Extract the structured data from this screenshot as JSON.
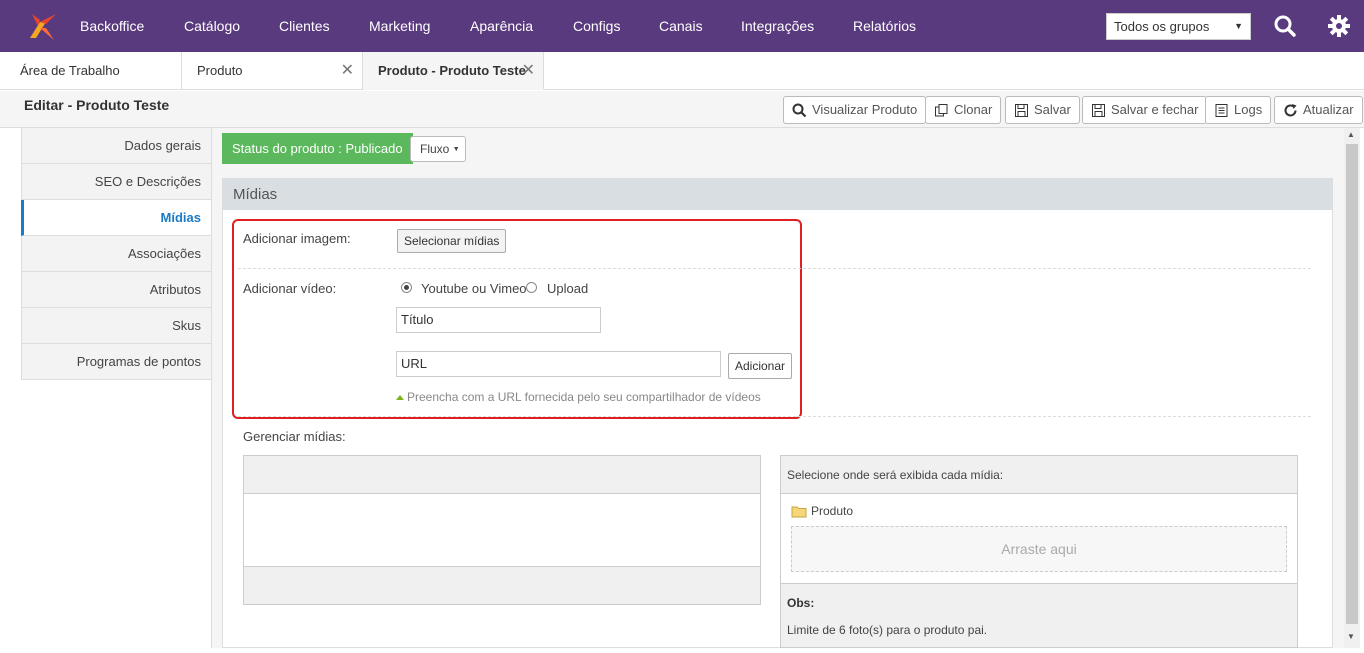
{
  "nav": {
    "brand": "Backoffice",
    "items": [
      "Catálogo",
      "Clientes",
      "Marketing",
      "Aparência",
      "Configs",
      "Canais",
      "Integrações",
      "Relatórios"
    ],
    "group_select": "Todos os grupos",
    "brand_color": "#5a3a7e"
  },
  "tabs": [
    {
      "label": "Área de Trabalho"
    },
    {
      "label": "Produto"
    },
    {
      "label": "Produto - Produto Teste"
    }
  ],
  "editor": {
    "title": "Editar - Produto Teste",
    "buttons": [
      "Visualizar Produto",
      "Clonar",
      "Salvar",
      "Salvar e fechar",
      "Logs",
      "Atualizar"
    ]
  },
  "sidemenu": [
    "Dados gerais",
    "SEO e Descrições",
    "Mídias",
    "Associações",
    "Atributos",
    "Skus",
    "Programas de pontos"
  ],
  "status": {
    "label": "Status do produto : Publicado",
    "flow": "Fluxo"
  },
  "midias": {
    "panel_title": "Mídias",
    "add_image_label": "Adicionar imagem:",
    "select_media_button": "Selecionar mídias",
    "add_video_label": "Adicionar vídeo:",
    "radio_youtube": "Youtube ou Vimeo",
    "radio_upload": "Upload",
    "title_value": "Título",
    "url_value": "URL",
    "add_button": "Adicionar",
    "hint": "Preencha com a URL fornecida pelo seu compartilhador de vídeos",
    "manage_label": "Gerenciar mídias:",
    "select_location": "Selecione onde será exibida cada mídia:",
    "folder_label": "Produto",
    "dropzone": "Arraste aqui",
    "obs_title": "Obs:",
    "obs_text": "Limite de 6 foto(s) para o produto pai."
  }
}
